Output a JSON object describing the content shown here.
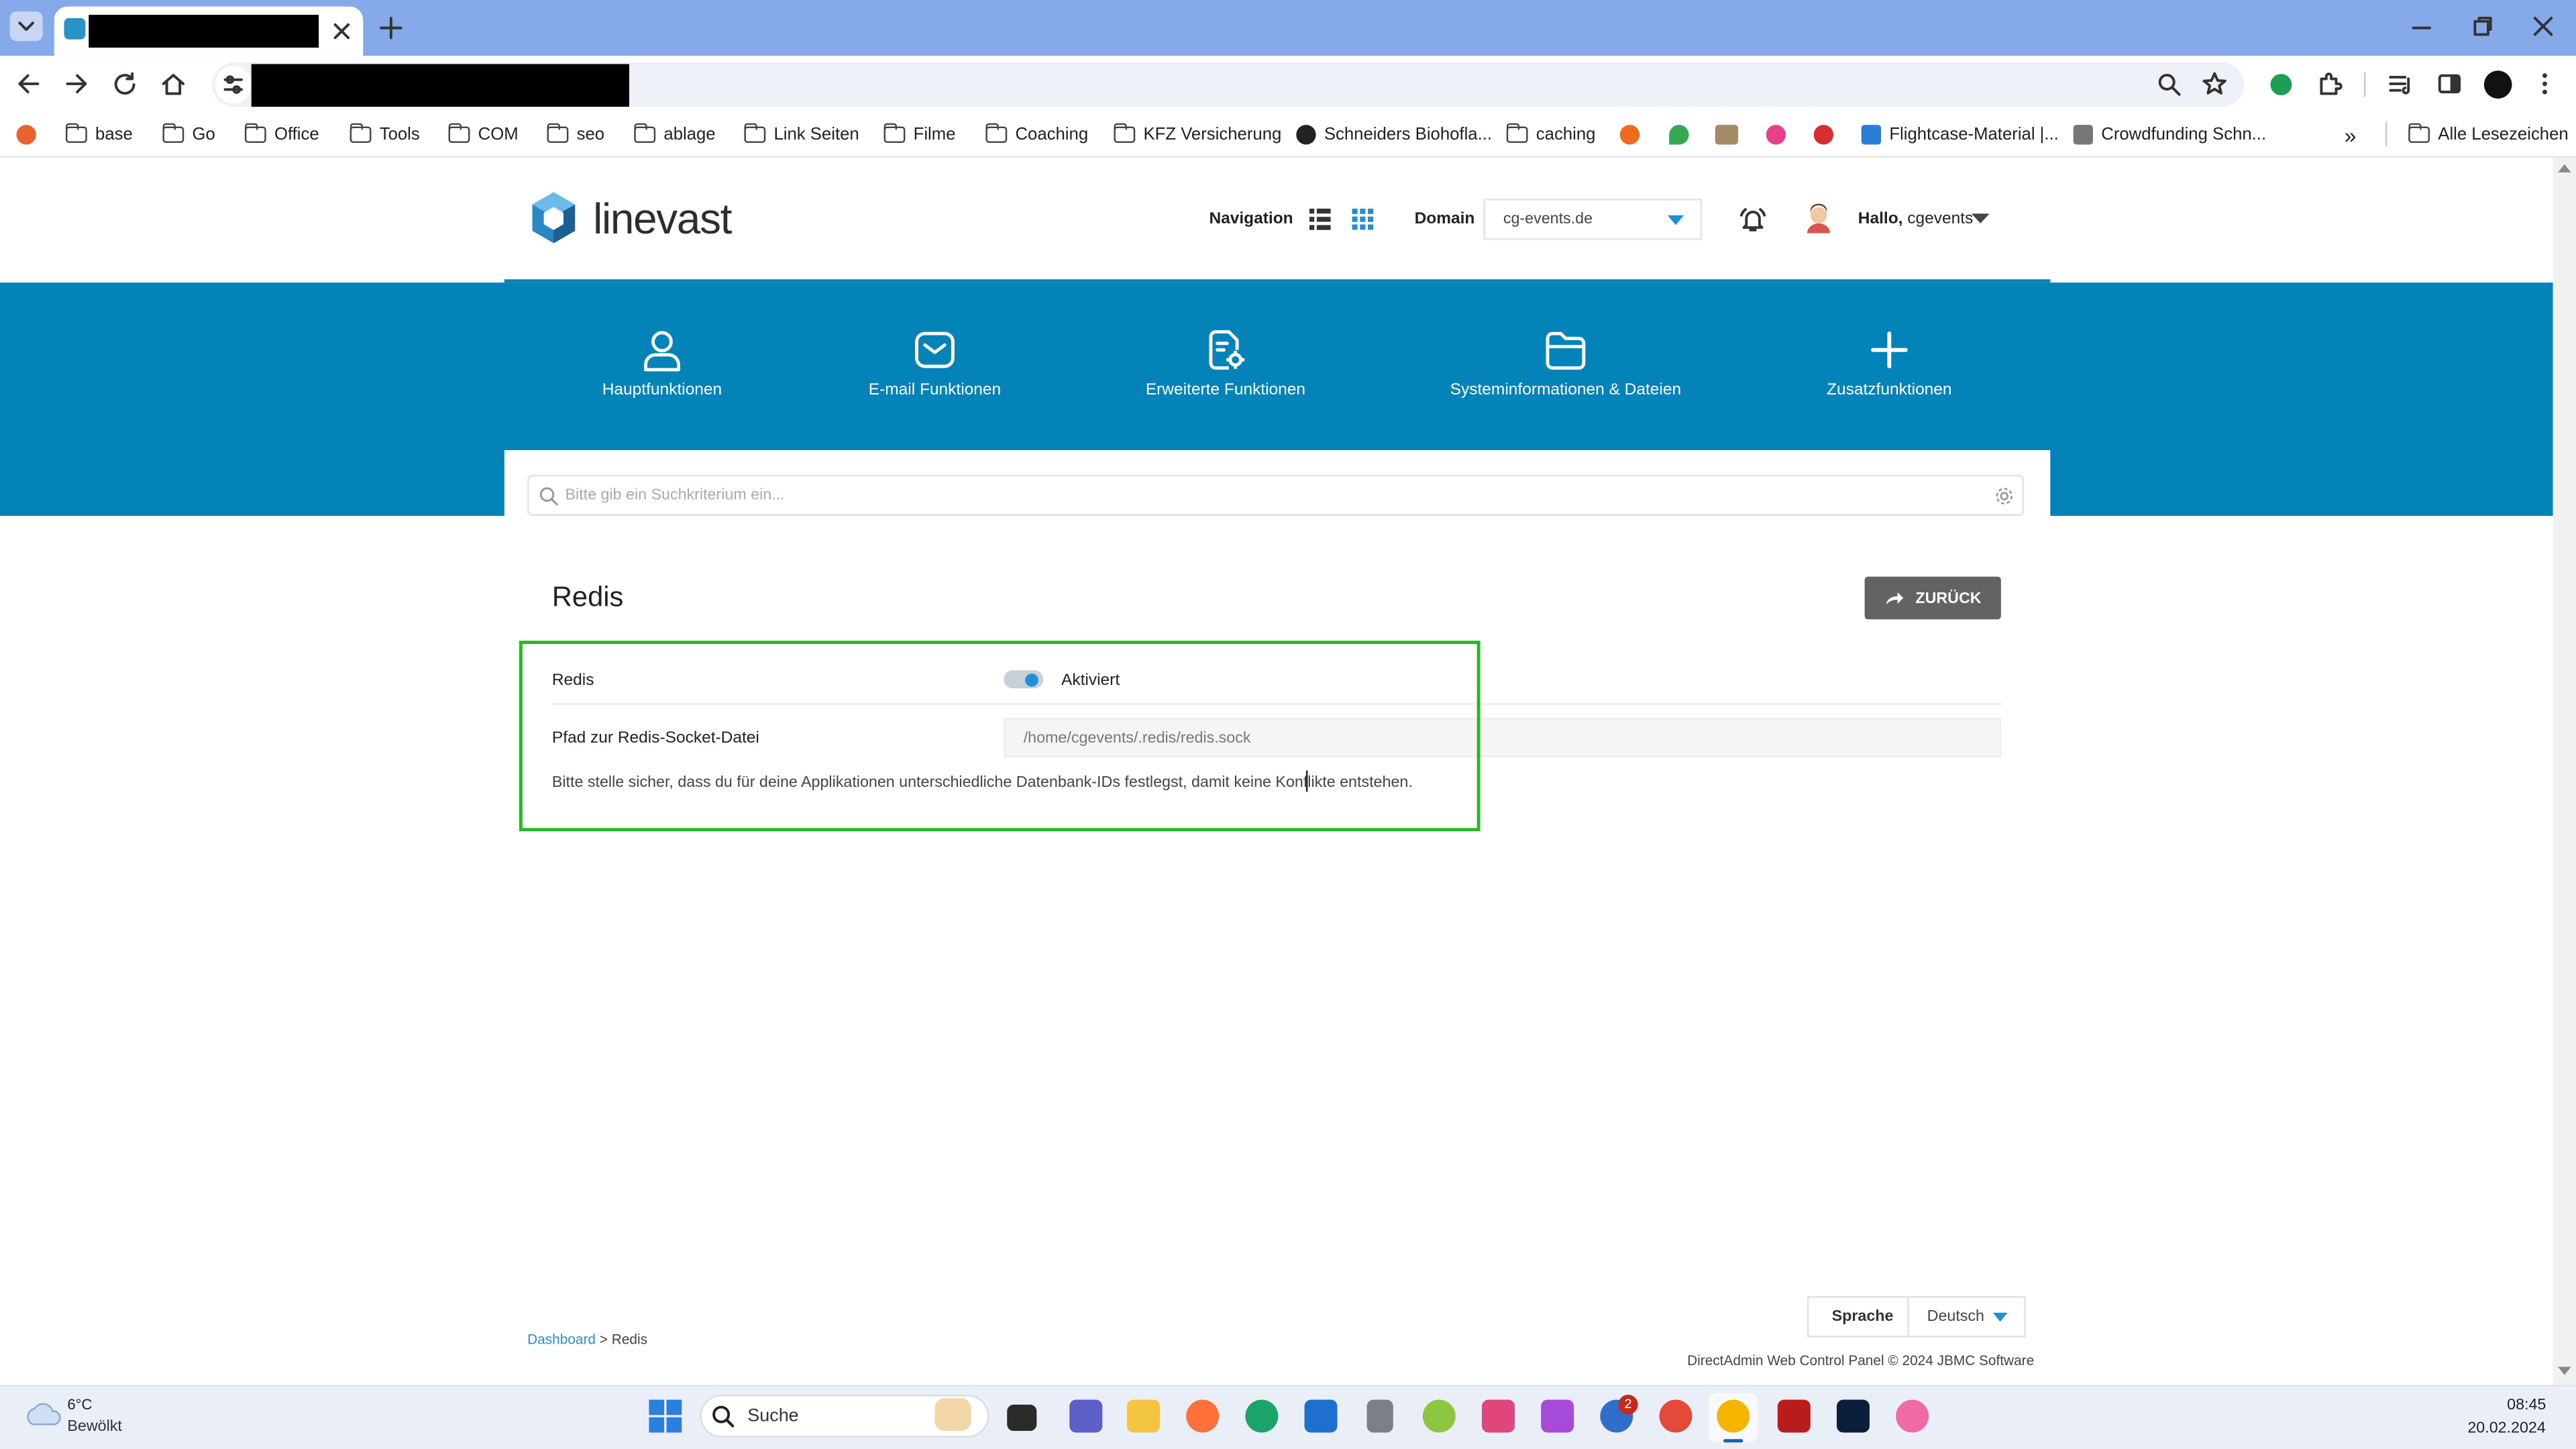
{
  "browser": {
    "bookmarks": [
      "base",
      "Go",
      "Office",
      "Tools",
      "COM",
      "seo",
      "ablage",
      "Link Seiten",
      "Filme",
      "Coaching",
      "KFZ Versicherung",
      "Schneiders Biohofla...",
      "caching",
      "Flightcase-Material |...",
      "Crowdfunding Schn..."
    ],
    "all_bookmarks": "Alle Lesezeichen",
    "overflow": "»"
  },
  "header": {
    "logo": "linevast",
    "navigation_label": "Navigation",
    "domain_label": "Domain",
    "domain_value": "cg-events.de",
    "greeting": "Hallo,",
    "user": "cgevents"
  },
  "main_nav": [
    {
      "label": "Hauptfunktionen",
      "icon": "user-icon"
    },
    {
      "label": "E-mail Funktionen",
      "icon": "mail-icon"
    },
    {
      "label": "Erweiterte Funktionen",
      "icon": "document-gear-icon"
    },
    {
      "label": "Systeminformationen & Dateien",
      "icon": "folder-icon"
    },
    {
      "label": "Zusatzfunktionen",
      "icon": "plus-icon"
    }
  ],
  "search": {
    "placeholder": "Bitte gib ein Suchkriterium ein..."
  },
  "page": {
    "title": "Redis",
    "back_label": "ZURÜCK",
    "redis_label": "Redis",
    "status": "Aktiviert",
    "toggle_on": true,
    "path_label": "Pfad zur Redis-Socket-Datei",
    "path_value": "/home/cgevents/.redis/redis.sock",
    "hint": "Bitte stelle sicher, dass du für deine Applikationen unterschiedliche Datenbank-IDs festlegst, damit keine Konflikte entstehen."
  },
  "footer": {
    "breadcrumb_link": "Dashboard",
    "breadcrumb_sep": ">",
    "breadcrumb_current": "Redis",
    "language_label": "Sprache",
    "language_value": "Deutsch",
    "copyright": "DirectAdmin Web Control Panel © 2024 JBMC Software"
  },
  "taskbar": {
    "temperature": "6°C",
    "weather": "Bewölkt",
    "search_label": "Suche",
    "badge_count": "2",
    "time": "08:45",
    "date": "20.02.2024"
  },
  "colors": {
    "brand_blue": "#0383b8",
    "highlight": "#2bb52b",
    "toggle": "#1e8fd8",
    "tab_bar": "#86a9e9"
  }
}
